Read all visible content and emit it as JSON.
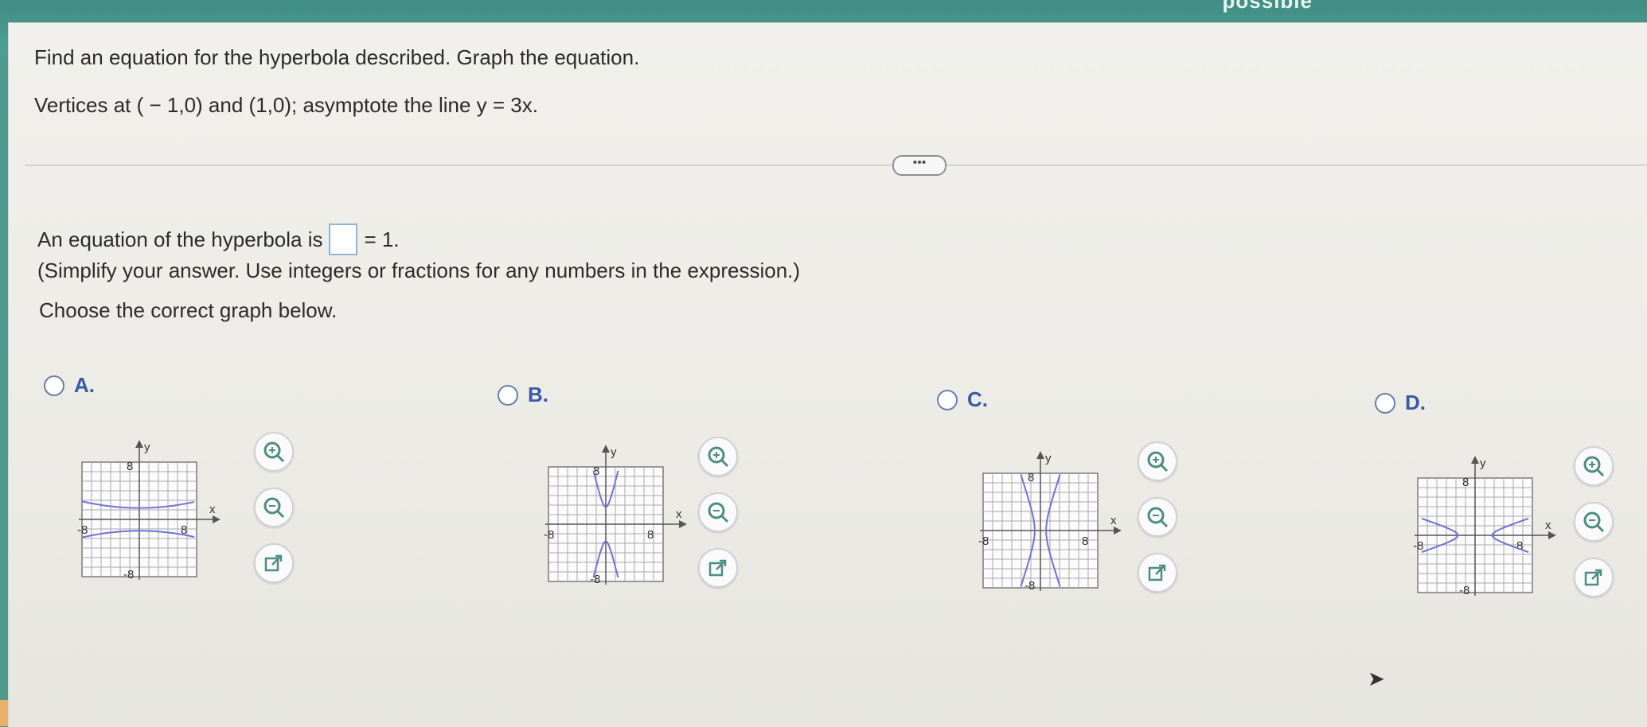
{
  "top_bar": {
    "partial_text": "possible"
  },
  "question": {
    "prompt": "Find an equation for the hyperbola described. Graph the equation.",
    "given": "Vertices at ( − 1,0) and (1,0); asymptote the line y = 3x."
  },
  "more_button_label": "•••",
  "answer": {
    "prefix": "An equation of the hyperbola is",
    "suffix": "= 1.",
    "input_value": "",
    "instruction": "(Simplify your answer. Use integers or fractions for any numbers in the expression.)"
  },
  "choose_prompt": "Choose the correct graph below.",
  "options": [
    {
      "letter": "A.",
      "type": "vertical-opening"
    },
    {
      "letter": "B.",
      "type": "vertical-steep"
    },
    {
      "letter": "C.",
      "type": "horizontal-steep"
    },
    {
      "letter": "D.",
      "type": "horizontal-wide"
    }
  ],
  "graph_labels": {
    "x": "x",
    "y": "y",
    "pos": "8",
    "neg": "-8"
  },
  "icons": {
    "zoom_in": "zoom-in-icon",
    "zoom_out": "zoom-out-icon",
    "open": "open-new-window-icon"
  },
  "colors": {
    "curve": "#6f74d6",
    "radio_text": "#3a5aa8",
    "top_bar": "#4e9a8e"
  }
}
